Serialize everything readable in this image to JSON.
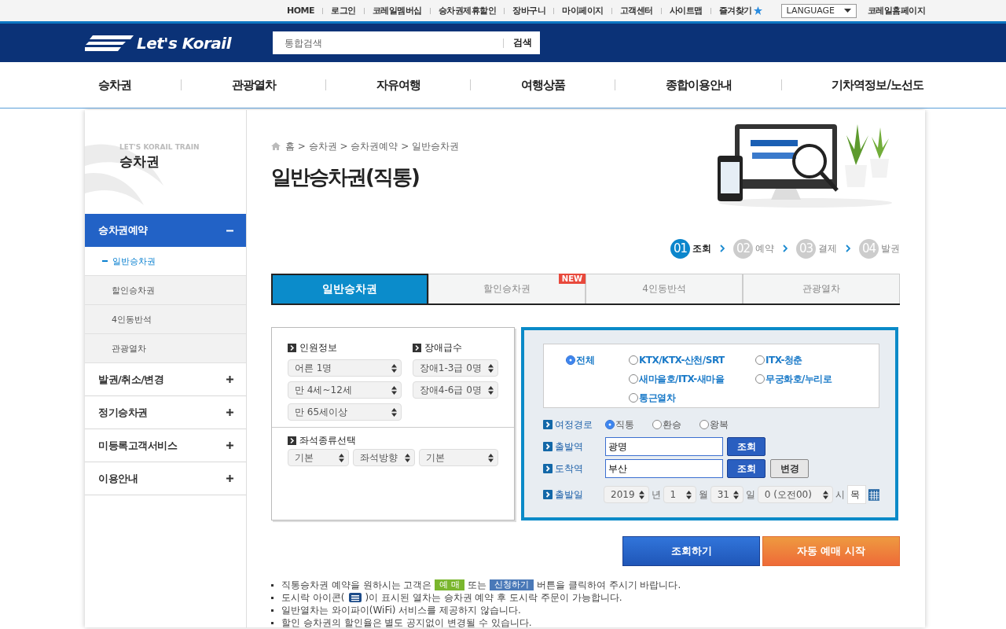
{
  "utility_bar": [
    {
      "kind": "link",
      "label": "HOME"
    },
    {
      "kind": "link",
      "label": "로그인"
    },
    {
      "kind": "link",
      "label": "코레일멤버십"
    },
    {
      "kind": "link",
      "label": "승차권제휴할인"
    },
    {
      "kind": "link",
      "label": "장바구니"
    },
    {
      "kind": "link",
      "label": "마이페이지"
    },
    {
      "kind": "link",
      "label": "고객센터"
    },
    {
      "kind": "link",
      "label": "사이트맵"
    },
    {
      "kind": "favorite",
      "label": "즐겨찾기"
    },
    {
      "kind": "select",
      "label": "LANGUAGE"
    },
    {
      "kind": "link",
      "label": "코레일홈페이지"
    }
  ],
  "header": {
    "logo": "Let's Korail",
    "search": {
      "placeholder": "통합검색",
      "button": "검색"
    }
  },
  "nav": [
    "승차권",
    "관광열차",
    "자유여행",
    "여행상품",
    "종합이용안내",
    "기차역정보/노선도"
  ],
  "sidebar": {
    "subtitle": "LET'S KORAIL TRAIN",
    "title": "승차권",
    "menu": [
      {
        "label": "승차권예약",
        "expanded": true,
        "children": [
          {
            "label": "일반승차권",
            "selected": true
          },
          {
            "label": "할인승차권",
            "selected": false
          },
          {
            "label": "4인동반석",
            "selected": false
          },
          {
            "label": "관광열차",
            "selected": false
          }
        ]
      },
      {
        "label": "발권/취소/변경",
        "expanded": false
      },
      {
        "label": "정기승차권",
        "expanded": false
      },
      {
        "label": "미등록고객서비스",
        "expanded": false
      },
      {
        "label": "이용안내",
        "expanded": false
      }
    ]
  },
  "breadcrumb": "홈 > 승차권 > 승차권예약 > 일반승차권",
  "page_title": "일반승차권(직통)",
  "steps": [
    {
      "number": "01",
      "label": "조회",
      "selected": true
    },
    {
      "number": "02",
      "label": "예약",
      "selected": false
    },
    {
      "number": "03",
      "label": "결제",
      "selected": false
    },
    {
      "number": "04",
      "label": "발권",
      "selected": false
    }
  ],
  "tabs": [
    {
      "label": "일반승차권",
      "selected": true
    },
    {
      "label": "할인승차권",
      "selected": false,
      "badge": "NEW"
    },
    {
      "label": "4인동반석",
      "selected": false
    },
    {
      "label": "관광열차",
      "selected": false
    }
  ],
  "passengers": {
    "title": "인원정보",
    "selects": [
      "어른 1명",
      "만 4세~12세",
      "만 65세이상"
    ]
  },
  "disability": {
    "title": "장애급수",
    "selects": [
      "장애1-3급 0명",
      "장애4-6급 0명"
    ]
  },
  "seat": {
    "title": "좌석종류선택",
    "selects": [
      "기본",
      "좌석방향",
      "기본"
    ]
  },
  "train_types": [
    {
      "label": "전체",
      "selected": true
    },
    {
      "label": "KTX/KTX-산천/SRT",
      "selected": false
    },
    {
      "label": "ITX-청춘",
      "selected": false
    },
    {
      "label": "새마을호/ITX-새마을",
      "selected": false
    },
    {
      "label": "무궁화호/누리로",
      "selected": false
    },
    {
      "label": "통근열차",
      "selected": false
    }
  ],
  "route": {
    "label": "여정경로",
    "options": [
      {
        "label": "직통",
        "selected": true
      },
      {
        "label": "환승",
        "selected": false
      },
      {
        "label": "왕복",
        "selected": false
      }
    ]
  },
  "stations": [
    {
      "label": "출발역",
      "value": "광명",
      "buttons": [
        {
          "kind": "primary",
          "label": "조회"
        }
      ]
    },
    {
      "label": "도착역",
      "value": "부산",
      "buttons": [
        {
          "kind": "primary",
          "label": "조회"
        },
        {
          "kind": "secondary",
          "label": "변경"
        }
      ]
    }
  ],
  "date": {
    "label": "출발일",
    "fields": [
      {
        "value": "2019",
        "unit": "년"
      },
      {
        "value": "1",
        "unit": "월"
      },
      {
        "value": "31",
        "unit": "일"
      },
      {
        "value": "0 (오전00)",
        "unit": "시"
      }
    ],
    "weekday": "목"
  },
  "actions": [
    {
      "kind": "primary",
      "label": "조회하기"
    },
    {
      "kind": "auto",
      "label": "자동 예매 시작"
    }
  ],
  "notices": [
    {
      "parts": [
        {
          "kind": "text",
          "text": "직통승차권 예약을 원하시는 고객은"
        },
        {
          "kind": "badge",
          "text": "예 매",
          "color": "#7ab62e"
        },
        {
          "kind": "text",
          "text": "또는"
        },
        {
          "kind": "badge",
          "text": "신청하기",
          "color": "#4a79b8"
        },
        {
          "kind": "text",
          "text": "버튼을 클릭하여 주시기 바랍니다."
        }
      ]
    },
    {
      "parts": [
        {
          "kind": "text",
          "text": "도시락 아이콘("
        },
        {
          "kind": "icon"
        },
        {
          "kind": "text",
          "text": ")이 표시된 열차는 승차권 예약 후 도시락 주문이 가능합니다."
        }
      ]
    },
    {
      "parts": [
        {
          "kind": "text",
          "text": "일반열차는 와이파이(WiFi) 서비스를 제공하지 않습니다."
        }
      ]
    },
    {
      "parts": [
        {
          "kind": "text",
          "text": "할인 승차권의 할인율은 별도 공지없이 변경될 수 있습니다."
        }
      ]
    }
  ]
}
